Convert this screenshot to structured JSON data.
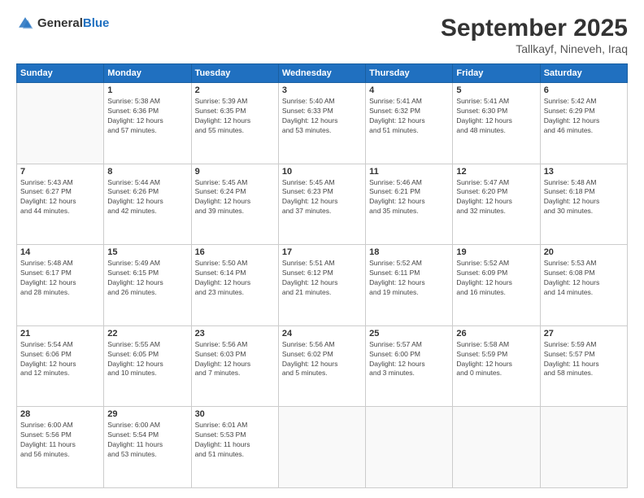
{
  "header": {
    "logo_general": "General",
    "logo_blue": "Blue",
    "month": "September 2025",
    "location": "Tallkayf, Nineveh, Iraq"
  },
  "days_of_week": [
    "Sunday",
    "Monday",
    "Tuesday",
    "Wednesday",
    "Thursday",
    "Friday",
    "Saturday"
  ],
  "weeks": [
    [
      {
        "day": "",
        "info": ""
      },
      {
        "day": "1",
        "info": "Sunrise: 5:38 AM\nSunset: 6:36 PM\nDaylight: 12 hours\nand 57 minutes."
      },
      {
        "day": "2",
        "info": "Sunrise: 5:39 AM\nSunset: 6:35 PM\nDaylight: 12 hours\nand 55 minutes."
      },
      {
        "day": "3",
        "info": "Sunrise: 5:40 AM\nSunset: 6:33 PM\nDaylight: 12 hours\nand 53 minutes."
      },
      {
        "day": "4",
        "info": "Sunrise: 5:41 AM\nSunset: 6:32 PM\nDaylight: 12 hours\nand 51 minutes."
      },
      {
        "day": "5",
        "info": "Sunrise: 5:41 AM\nSunset: 6:30 PM\nDaylight: 12 hours\nand 48 minutes."
      },
      {
        "day": "6",
        "info": "Sunrise: 5:42 AM\nSunset: 6:29 PM\nDaylight: 12 hours\nand 46 minutes."
      }
    ],
    [
      {
        "day": "7",
        "info": "Sunrise: 5:43 AM\nSunset: 6:27 PM\nDaylight: 12 hours\nand 44 minutes."
      },
      {
        "day": "8",
        "info": "Sunrise: 5:44 AM\nSunset: 6:26 PM\nDaylight: 12 hours\nand 42 minutes."
      },
      {
        "day": "9",
        "info": "Sunrise: 5:45 AM\nSunset: 6:24 PM\nDaylight: 12 hours\nand 39 minutes."
      },
      {
        "day": "10",
        "info": "Sunrise: 5:45 AM\nSunset: 6:23 PM\nDaylight: 12 hours\nand 37 minutes."
      },
      {
        "day": "11",
        "info": "Sunrise: 5:46 AM\nSunset: 6:21 PM\nDaylight: 12 hours\nand 35 minutes."
      },
      {
        "day": "12",
        "info": "Sunrise: 5:47 AM\nSunset: 6:20 PM\nDaylight: 12 hours\nand 32 minutes."
      },
      {
        "day": "13",
        "info": "Sunrise: 5:48 AM\nSunset: 6:18 PM\nDaylight: 12 hours\nand 30 minutes."
      }
    ],
    [
      {
        "day": "14",
        "info": "Sunrise: 5:48 AM\nSunset: 6:17 PM\nDaylight: 12 hours\nand 28 minutes."
      },
      {
        "day": "15",
        "info": "Sunrise: 5:49 AM\nSunset: 6:15 PM\nDaylight: 12 hours\nand 26 minutes."
      },
      {
        "day": "16",
        "info": "Sunrise: 5:50 AM\nSunset: 6:14 PM\nDaylight: 12 hours\nand 23 minutes."
      },
      {
        "day": "17",
        "info": "Sunrise: 5:51 AM\nSunset: 6:12 PM\nDaylight: 12 hours\nand 21 minutes."
      },
      {
        "day": "18",
        "info": "Sunrise: 5:52 AM\nSunset: 6:11 PM\nDaylight: 12 hours\nand 19 minutes."
      },
      {
        "day": "19",
        "info": "Sunrise: 5:52 AM\nSunset: 6:09 PM\nDaylight: 12 hours\nand 16 minutes."
      },
      {
        "day": "20",
        "info": "Sunrise: 5:53 AM\nSunset: 6:08 PM\nDaylight: 12 hours\nand 14 minutes."
      }
    ],
    [
      {
        "day": "21",
        "info": "Sunrise: 5:54 AM\nSunset: 6:06 PM\nDaylight: 12 hours\nand 12 minutes."
      },
      {
        "day": "22",
        "info": "Sunrise: 5:55 AM\nSunset: 6:05 PM\nDaylight: 12 hours\nand 10 minutes."
      },
      {
        "day": "23",
        "info": "Sunrise: 5:56 AM\nSunset: 6:03 PM\nDaylight: 12 hours\nand 7 minutes."
      },
      {
        "day": "24",
        "info": "Sunrise: 5:56 AM\nSunset: 6:02 PM\nDaylight: 12 hours\nand 5 minutes."
      },
      {
        "day": "25",
        "info": "Sunrise: 5:57 AM\nSunset: 6:00 PM\nDaylight: 12 hours\nand 3 minutes."
      },
      {
        "day": "26",
        "info": "Sunrise: 5:58 AM\nSunset: 5:59 PM\nDaylight: 12 hours\nand 0 minutes."
      },
      {
        "day": "27",
        "info": "Sunrise: 5:59 AM\nSunset: 5:57 PM\nDaylight: 11 hours\nand 58 minutes."
      }
    ],
    [
      {
        "day": "28",
        "info": "Sunrise: 6:00 AM\nSunset: 5:56 PM\nDaylight: 11 hours\nand 56 minutes."
      },
      {
        "day": "29",
        "info": "Sunrise: 6:00 AM\nSunset: 5:54 PM\nDaylight: 11 hours\nand 53 minutes."
      },
      {
        "day": "30",
        "info": "Sunrise: 6:01 AM\nSunset: 5:53 PM\nDaylight: 11 hours\nand 51 minutes."
      },
      {
        "day": "",
        "info": ""
      },
      {
        "day": "",
        "info": ""
      },
      {
        "day": "",
        "info": ""
      },
      {
        "day": "",
        "info": ""
      }
    ]
  ]
}
